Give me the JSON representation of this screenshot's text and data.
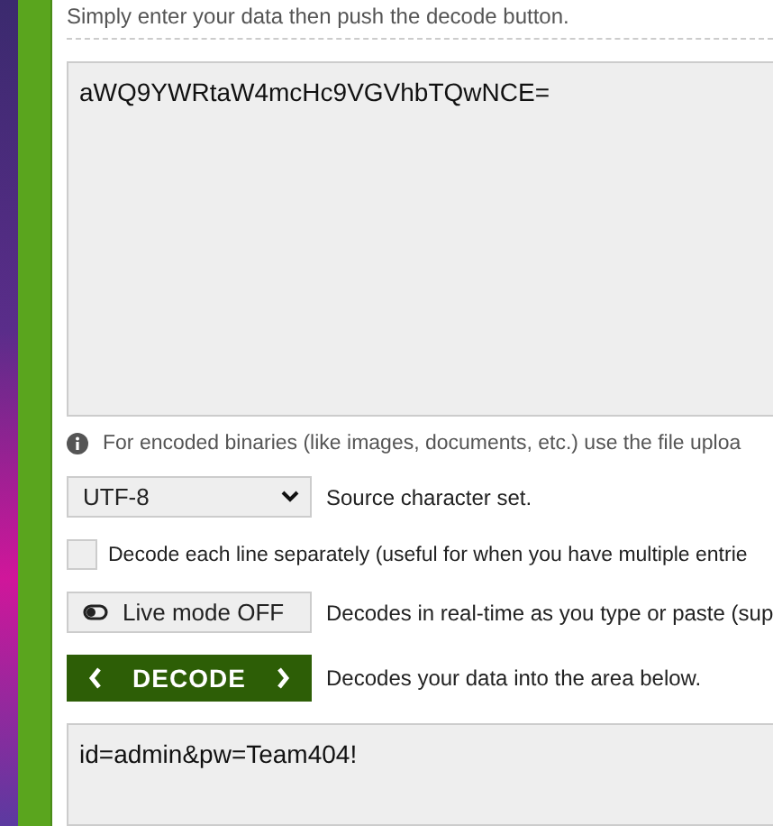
{
  "intro": "Simply enter your data then push the decode button.",
  "input": {
    "value": "aWQ9YWRtaW4mcHc9VGVhbTQwNCE="
  },
  "info": "For encoded binaries (like images, documents, etc.) use the file uploa",
  "charset": {
    "value": "UTF-8",
    "label": "Source character set."
  },
  "each_line": {
    "checked": false,
    "label": "Decode each line separately (useful for when you have multiple entrie"
  },
  "live_mode": {
    "on": false,
    "button": "Live mode OFF",
    "label": "Decodes in real-time as you type or paste (sup"
  },
  "decode": {
    "button": "DECODE",
    "label": "Decodes your data into the area below."
  },
  "output": {
    "value": "id=admin&pw=Team404!"
  }
}
